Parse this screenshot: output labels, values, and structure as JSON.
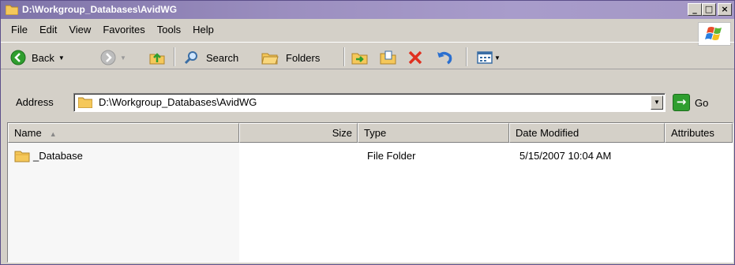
{
  "window": {
    "title": "D:\\Workgroup_Databases\\AvidWG",
    "buttons": [
      "_",
      "□",
      "×"
    ]
  },
  "menu": {
    "items": [
      {
        "label": "File",
        "accel": "F"
      },
      {
        "label": "Edit",
        "accel": "E"
      },
      {
        "label": "View",
        "accel": "V"
      },
      {
        "label": "Favorites",
        "accel": "a"
      },
      {
        "label": "Tools",
        "accel": "T"
      },
      {
        "label": "Help",
        "accel": "H"
      }
    ]
  },
  "toolbar": {
    "back_label": "Back",
    "search_label": "Search",
    "folders_label": "Folders"
  },
  "address": {
    "label": "Address",
    "value": "D:\\Workgroup_Databases\\AvidWG",
    "go_label": "Go"
  },
  "list": {
    "columns": [
      "Name",
      "Size",
      "Type",
      "Date Modified",
      "Attributes"
    ],
    "rows": [
      {
        "name": "_Database",
        "size": "",
        "type": "File Folder",
        "date": "5/15/2007 10:04 AM",
        "attributes": ""
      }
    ]
  },
  "colors": {
    "titlebar": "#9c8fc0",
    "face": "#d4d0c8",
    "folder": "#f5c85a"
  },
  "icons": [
    "folder-icon",
    "back-arrow-icon",
    "forward-arrow-icon",
    "up-folder-icon",
    "search-icon",
    "folders-icon",
    "move-to-icon",
    "copy-to-icon",
    "delete-icon",
    "undo-icon",
    "views-icon",
    "go-icon",
    "windows-logo-icon"
  ]
}
